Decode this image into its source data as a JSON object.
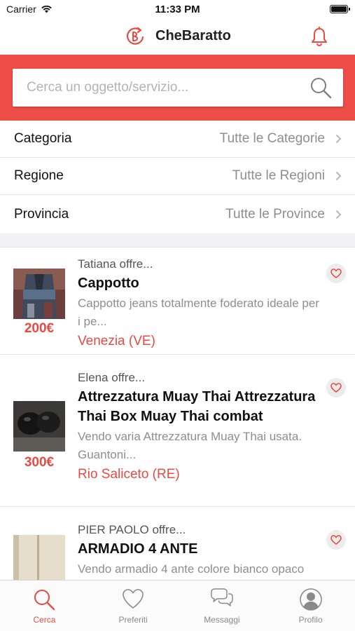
{
  "status": {
    "carrier": "Carrier",
    "time": "11:33 PM"
  },
  "app": {
    "title": "CheBaratto"
  },
  "search": {
    "placeholder": "Cerca un oggetto/servizio..."
  },
  "filters": [
    {
      "label": "Categoria",
      "value": "Tutte le Categorie"
    },
    {
      "label": "Regione",
      "value": "Tutte le Regioni"
    },
    {
      "label": "Provincia",
      "value": "Tutte le Province"
    }
  ],
  "listings": [
    {
      "offerer": "Tatiana offre...",
      "title": "Cappotto",
      "description": "Cappotto jeans totalmente foderato ideale per i pe...",
      "location": "Venezia (VE)",
      "price": "200€"
    },
    {
      "offerer": "Elena offre...",
      "title": "Attrezzatura Muay Thai Attrezzatura Thai Box Muay Thai combat",
      "description": "Vendo varia Attrezzatura Muay Thai usata. Guantoni...",
      "location": "Rio Saliceto (RE)",
      "price": "300€"
    },
    {
      "offerer": "PIER PAOLO offre...",
      "title": "ARMADIO 4 ANTE",
      "description": "Vendo armadio 4 ante colore bianco opaco",
      "location": "",
      "price": ""
    }
  ],
  "tabs": [
    {
      "label": "Cerca",
      "icon": "search-icon",
      "active": true
    },
    {
      "label": "Preferiti",
      "icon": "heart-icon",
      "active": false
    },
    {
      "label": "Messaggi",
      "icon": "chat-icon",
      "active": false
    },
    {
      "label": "Profilo",
      "icon": "profile-icon",
      "active": false
    }
  ],
  "colors": {
    "accent": "#ef4d48",
    "price": "#e94a43",
    "muted": "#8e8e8e"
  }
}
